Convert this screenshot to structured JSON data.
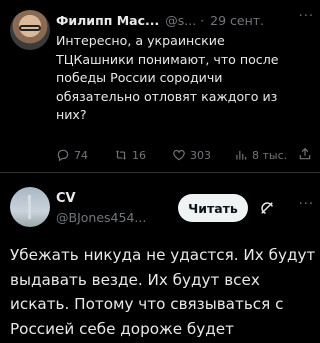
{
  "tweet1": {
    "author_name": "Филипп Мас...",
    "handle": "@s...",
    "separator": "·",
    "date": "29 сент.",
    "more": "···",
    "text": "Интересно, а украинские ТЦКашники понимают, что после победы России сородичи обязательно отловят каждого из них?",
    "replies": "74",
    "reposts": "16",
    "likes": "303",
    "views": "8 тыс."
  },
  "tweet2": {
    "author_name": "CV",
    "handle": "@BJones454...",
    "read_button": "Читать",
    "more": "···",
    "text": "Убежать никуда не удастся. Их будут выдавать везде. Их будут всех искать. Потому что связываться с Россией себе дороже будет"
  },
  "colors": {
    "background": "#000000",
    "text": "#e7e9ea",
    "secondary": "#71767b",
    "divider": "#2f3336",
    "button_bg": "#eff3f4"
  }
}
